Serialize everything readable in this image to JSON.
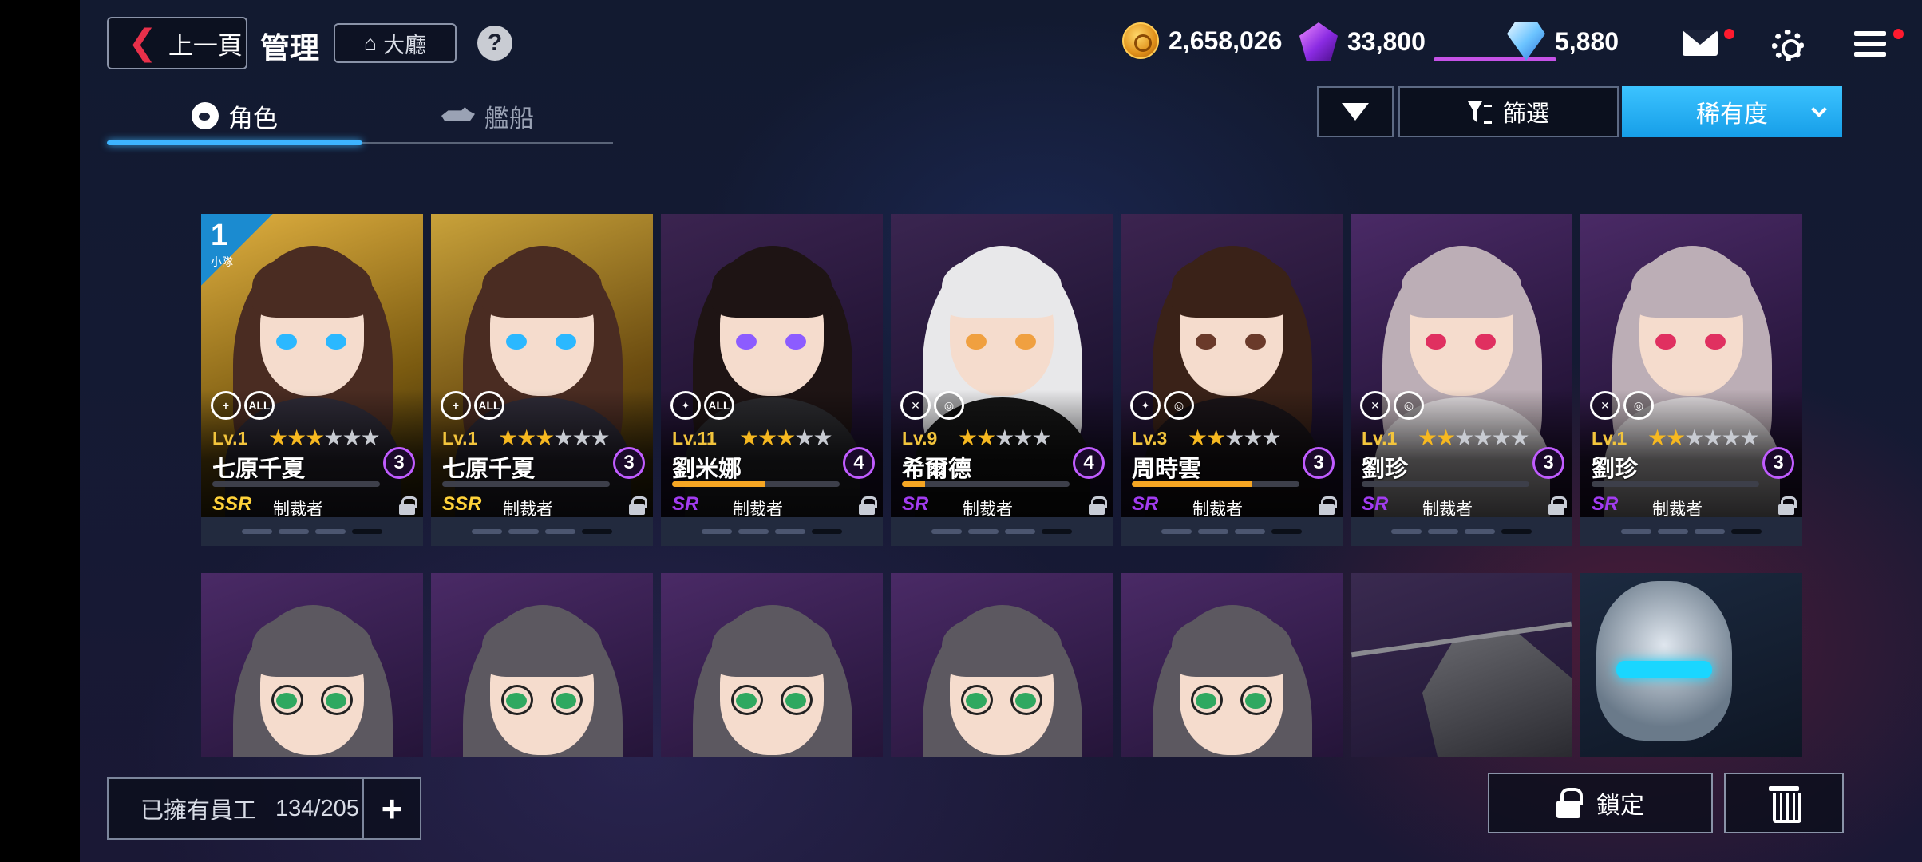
{
  "header": {
    "back_label": "上一頁",
    "title": "管理",
    "lobby_label": "大廳",
    "help_label": "?"
  },
  "resources": {
    "gold": "2,658,026",
    "crystal": "33,800",
    "diamond": "5,880"
  },
  "tabs": [
    {
      "label": "角色",
      "active": true
    },
    {
      "label": "艦船",
      "active": false
    }
  ],
  "toolbar": {
    "filter_label": "篩選",
    "sort_label": "稀有度"
  },
  "squad": {
    "number": "1",
    "label": "小隊"
  },
  "cards_row1": [
    {
      "level": "Lv.1",
      "stars": 3,
      "max_stars": 6,
      "name": "七原千夏",
      "rank": "3",
      "rarity": "SSR",
      "job": "制裁者",
      "roles": [
        "+",
        "ALL"
      ],
      "progress": 0
    },
    {
      "level": "Lv.1",
      "stars": 3,
      "max_stars": 6,
      "name": "七原千夏",
      "rank": "3",
      "rarity": "SSR",
      "job": "制裁者",
      "roles": [
        "+",
        "ALL"
      ],
      "progress": 0
    },
    {
      "level": "Lv.11",
      "stars": 3,
      "max_stars": 5,
      "name": "劉米娜",
      "rank": "4",
      "rarity": "SR",
      "job": "制裁者",
      "roles": [
        "✦",
        "ALL"
      ],
      "progress": 0.55
    },
    {
      "level": "Lv.9",
      "stars": 2,
      "max_stars": 5,
      "name": "希爾德",
      "rank": "4",
      "rarity": "SR",
      "job": "制裁者",
      "roles": [
        "✕",
        "◎"
      ],
      "progress": 0.14
    },
    {
      "level": "Lv.3",
      "stars": 2,
      "max_stars": 5,
      "name": "周時雲",
      "rank": "3",
      "rarity": "SR",
      "job": "制裁者",
      "roles": [
        "✦",
        "◎"
      ],
      "progress": 0.72
    },
    {
      "level": "Lv.1",
      "stars": 2,
      "max_stars": 6,
      "name": "劉珍",
      "rank": "3",
      "rarity": "SR",
      "job": "制裁者",
      "roles": [
        "✕",
        "◎"
      ],
      "progress": 0
    },
    {
      "level": "Lv.1",
      "stars": 2,
      "max_stars": 6,
      "name": "劉珍",
      "rank": "3",
      "rarity": "SR",
      "job": "制裁者",
      "roles": [
        "✕",
        "◎"
      ],
      "progress": 0
    }
  ],
  "bottom": {
    "owned_label": "已擁有員工",
    "owned_value": "134/205",
    "plus_label": "+",
    "lock_label": "鎖定"
  },
  "colors": {
    "accent_blue": "#1fa8f0",
    "ssr": "#ffd23a",
    "sr": "#a23cf0",
    "badge_border": "#c05cff",
    "notification": "#ff1a2e"
  }
}
